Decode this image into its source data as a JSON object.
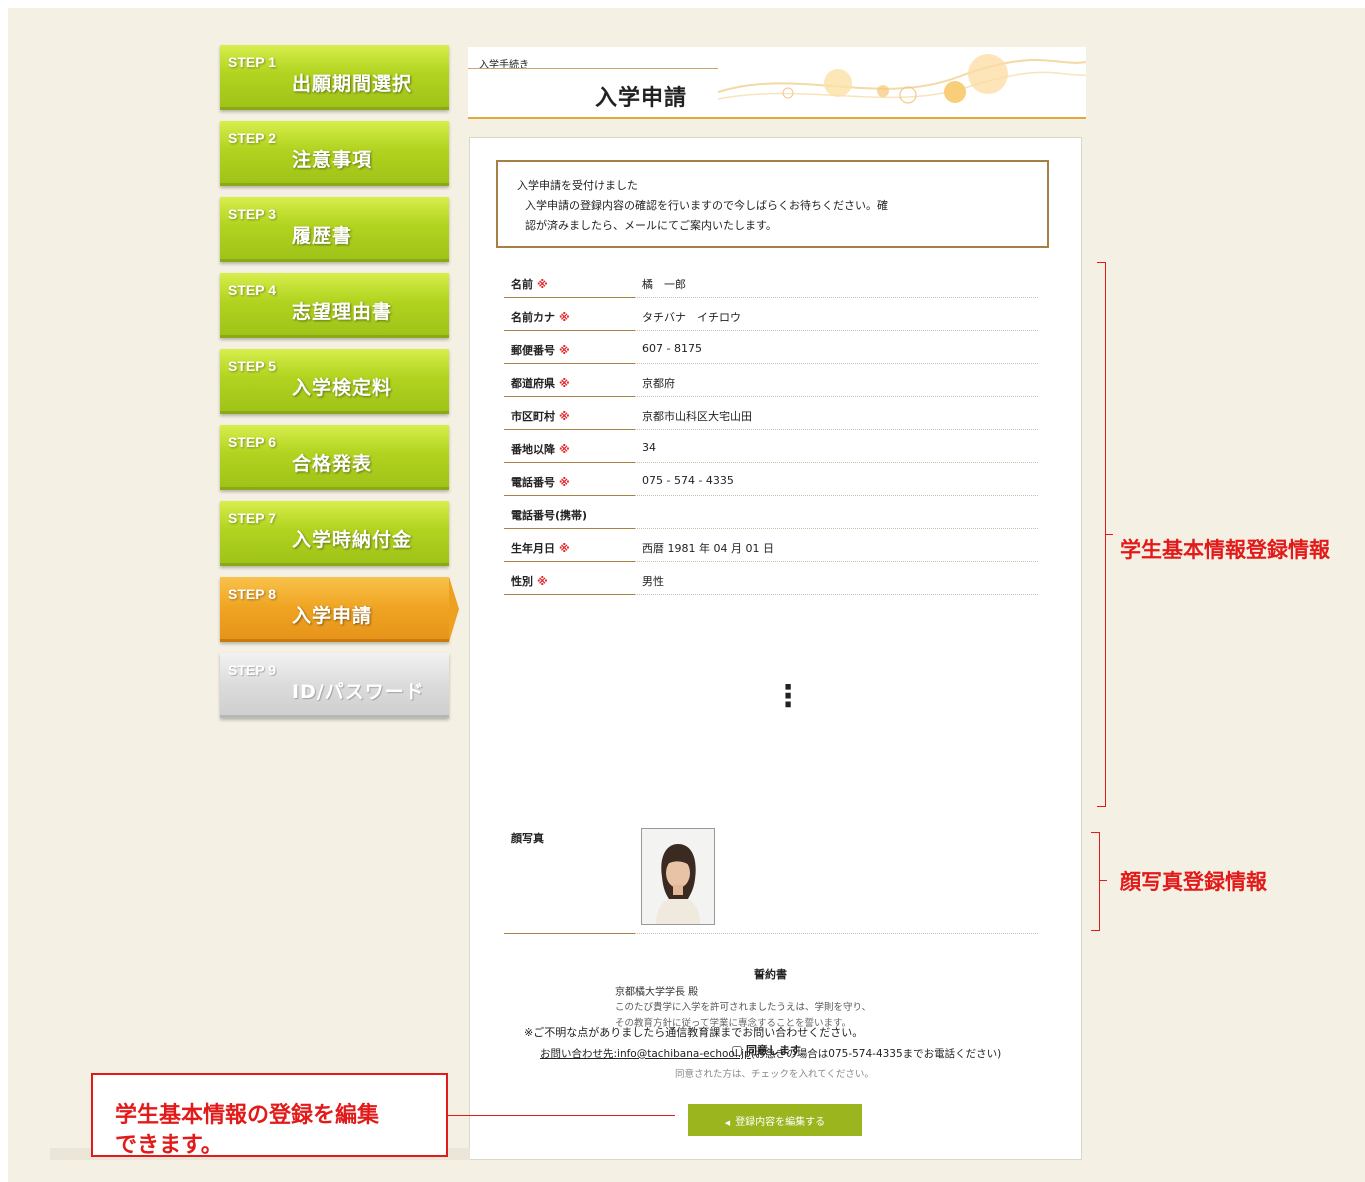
{
  "steps": [
    {
      "num": "STEP 1",
      "title": "出願期間選択"
    },
    {
      "num": "STEP 2",
      "title": "注意事項"
    },
    {
      "num": "STEP 3",
      "title": "履歴書"
    },
    {
      "num": "STEP 4",
      "title": "志望理由書"
    },
    {
      "num": "STEP 5",
      "title": "入学検定料"
    },
    {
      "num": "STEP 6",
      "title": "合格発表"
    },
    {
      "num": "STEP 7",
      "title": "入学時納付金"
    },
    {
      "num": "STEP 8",
      "title": "入学申請"
    },
    {
      "num": "STEP 9",
      "title": "ID/パスワード"
    }
  ],
  "header": {
    "breadcrumb": "入学手続き",
    "title": "入学申請"
  },
  "notice": {
    "line1": "入学申請を受付けました",
    "line2": "入学申請の登録内容の確認を行いますので今しばらくお待ちください。確",
    "line3": "認が済みましたら、メールにてご案内いたします。"
  },
  "required_mark": "※",
  "fields": [
    {
      "label": "名前",
      "required": true,
      "value": "橘　一郎"
    },
    {
      "label": "名前カナ",
      "required": true,
      "value": "タチバナ　イチロウ"
    },
    {
      "label": "郵便番号",
      "required": true,
      "value": "607 - 8175"
    },
    {
      "label": "都道府県",
      "required": true,
      "value": "京都府"
    },
    {
      "label": "市区町村",
      "required": true,
      "value": "京都市山科区大宅山田"
    },
    {
      "label": "番地以降",
      "required": true,
      "value": "34"
    },
    {
      "label": "電話番号",
      "required": true,
      "value": "075 - 574 - 4335"
    },
    {
      "label": "電話番号(携帯)",
      "required": false,
      "value": ""
    },
    {
      "label": "生年月日",
      "required": true,
      "value": "西暦 1981 年 04 月 01 日"
    },
    {
      "label": "性別",
      "required": true,
      "value": "男性"
    }
  ],
  "ellipsis": "⋮",
  "photo": {
    "label": "顔写真"
  },
  "pledge": {
    "title": "誓約書",
    "to": "京都橘大学学長 殿",
    "body1": "このたび貴学に入学を許可されましたうえは、学則を守り、",
    "body2": "その教育方針に従って学業に専念することを誓います。"
  },
  "inquiry_note": "※ご不明な点がありましたら通信教育課までお問い合わせください。",
  "agree_label": "同意します",
  "contact": {
    "link": "お問い合わせ先:info@tachibana-echool.jp",
    "rest": "(お急ぎの場合は075-574-4335までお電話ください)"
  },
  "check_hint": "同意された方は、チェックを入れてください。",
  "edit_button": "登録内容を編集する",
  "annotations": {
    "basic_info": "学生基本情報登録情報",
    "photo_info": "顔写真登録情報",
    "callout_line1": "学生基本情報の登録を編集",
    "callout_line2": "できます。"
  },
  "colors": {
    "step_green": "#b2d420",
    "step_active": "#f0a422",
    "step_disabled": "#dcdcdc",
    "required": "#e0262a",
    "annotation": "#e21a1a",
    "button": "#9bb51f"
  }
}
